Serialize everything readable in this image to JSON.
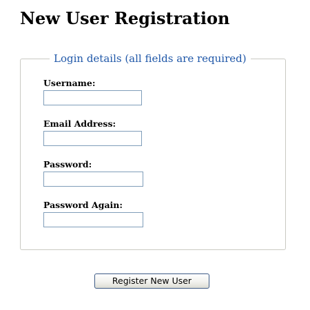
{
  "page": {
    "title": "New User Registration"
  },
  "form": {
    "legend": "Login details (all fields are required)",
    "fields": [
      {
        "label": "Username:",
        "value": ""
      },
      {
        "label": "Email Address:",
        "value": ""
      },
      {
        "label": "Password:",
        "value": ""
      },
      {
        "label": "Password Again:",
        "value": ""
      }
    ],
    "submit_label": "Register New User"
  },
  "colors": {
    "legend_text": "#1f57a8",
    "fieldset_border": "#c9c9c2",
    "input_border": "#7f9db9",
    "button_border": "#3c5a85"
  }
}
